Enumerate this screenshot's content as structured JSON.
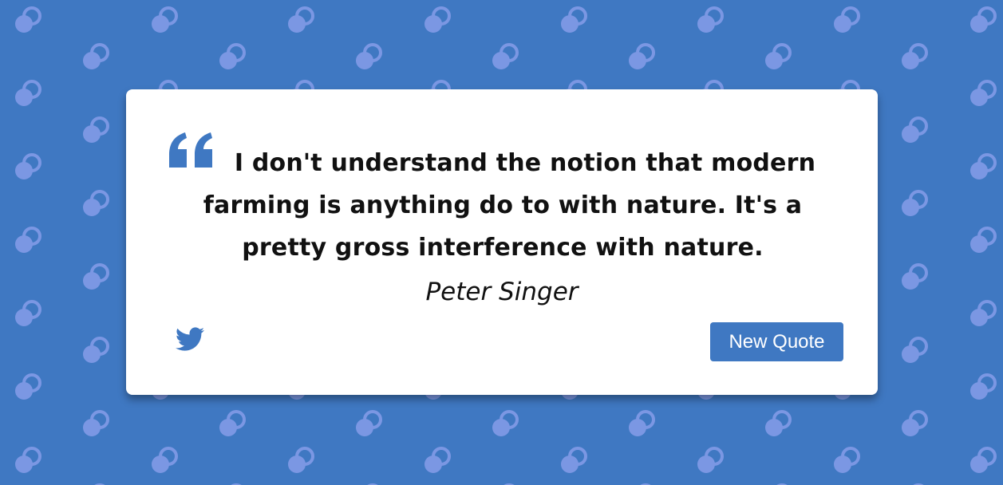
{
  "theme": {
    "background": "#3f78c2",
    "accent": "#3f78c2",
    "pattern_color": "#7b97e3"
  },
  "quote": {
    "text": "I don't understand the notion that modern farming is anything do to with nature. It's a pretty gross interference with nature.",
    "author": "Peter Singer"
  },
  "actions": {
    "tweet_icon": "twitter-bird-icon",
    "new_quote_label": "New Quote"
  }
}
